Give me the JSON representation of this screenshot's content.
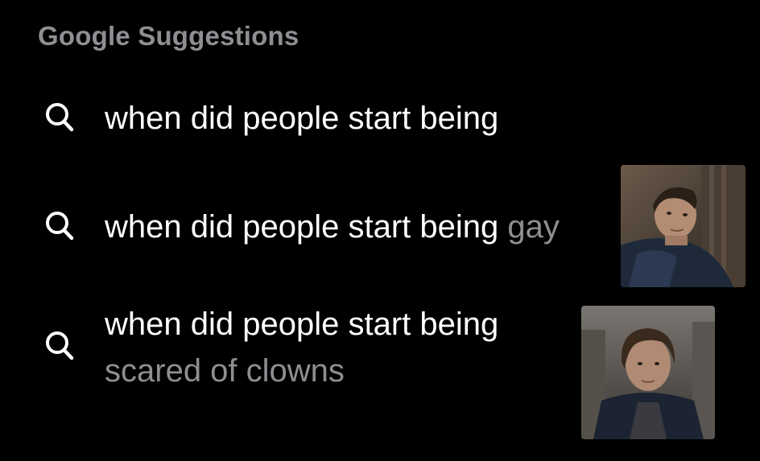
{
  "header": {
    "title": "Google Suggestions"
  },
  "suggestions": [
    {
      "icon": "search-icon",
      "typed": "when did people start being",
      "completion": "",
      "has_thumbnail": false
    },
    {
      "icon": "search-icon",
      "typed": "when did people start being",
      "completion": "gay",
      "has_thumbnail": true
    },
    {
      "icon": "search-icon",
      "typed": "when did people start being",
      "completion": "scared of clowns",
      "has_thumbnail": true
    }
  ],
  "colors": {
    "background": "#000000",
    "primary_text": "#ffffff",
    "secondary_text": "#8e8e93"
  }
}
